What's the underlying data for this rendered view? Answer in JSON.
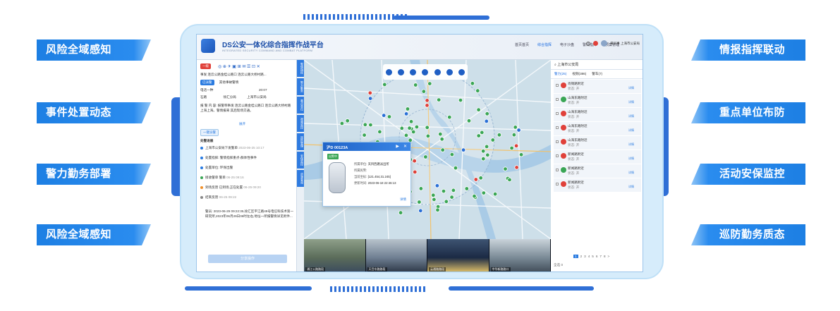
{
  "left_features": [
    "风险全域感知",
    "事件处置动态",
    "警力勤务部署",
    "风险全域感知"
  ],
  "right_features": [
    "情报指挥联动",
    "重点单位布防",
    "活动安保监控",
    "巡防勤务质态"
  ],
  "app": {
    "title": "DS公安一体化综合指挥作战平台",
    "subtitle": "INTEGRATED SECURITY COMMAND AND COMBAT PLATFORM",
    "nav": [
      "首页首页",
      "综合指挥",
      "电子沙盘",
      "警情指挥",
      "预案管理"
    ],
    "nav_active": 1,
    "user_label": "黄同事 上海市公安局"
  },
  "left_panel": {
    "tag": "一级",
    "event_title": "事发 连云公路金桂公路口 连云公路大桥村路...",
    "tags": [
      "已派警",
      "其他事故警情"
    ],
    "phone_label": "电话一种",
    "time_label": "20:07",
    "row3_a": "石路",
    "row3_b": "徐汇分局",
    "row3_c": "上海市公安局",
    "report_text": "报 警 内 容: 报警称事发 连云公路金桂公路口 连云公路大桥村路 上海上海。警情报来 其后现场交通。",
    "expand_label": "展开",
    "section_btn": "一键派警",
    "section_title": "处警进展",
    "timeline": [
      {
        "time": "2023-06-25 10:17",
        "text": "上海市公安局下发警单",
        "color": "#2a7be0"
      },
      {
        "time": "",
        "text": "处置指挥: 警情指挥重点-群体性事件",
        "color": "#2a7be0"
      },
      {
        "time": "",
        "text": "处置单位: 环保出警",
        "color": "#2a7be0"
      },
      {
        "time": "06-25 09:16",
        "text": "接收警单 警单",
        "color": "#3aa655"
      },
      {
        "time": "06-25 09:20",
        "text": "到场反馈 已到场,正在处置",
        "color": "#f0902a"
      },
      {
        "time": "06-25 09:22",
        "text": "结束反馈",
        "color": "#888888"
      }
    ],
    "feedback_text": "警员: 2023-06-29 09:22:35,徐汇区平江路49号电信科技术第一研究所,2023年06月29日08时左右,地址一所报警情详见附件...",
    "submit_label": "分享操作"
  },
  "vertical_tabs": [
    "警情指挥",
    "警力勤务",
    "重点单位",
    "视频监控",
    "巡防管理",
    "安保监控",
    "资源查询"
  ],
  "map_search": {
    "placeholder": "上海市公安局"
  },
  "popup": {
    "title": "沪D 00123A",
    "badge": "出警中",
    "fields": [
      {
        "k": "所属单位",
        "v": "天目西路派出所"
      },
      {
        "k": "所属民警",
        "v": ""
      },
      {
        "k": "当前坐标",
        "v": "[121.454,31.245]"
      },
      {
        "k": "更新时间",
        "v": "2023-06-18 22:46:13"
      }
    ],
    "link": "详情"
  },
  "videos": [
    {
      "label": "浦江公路路段"
    },
    {
      "label": "天目东路路段"
    },
    {
      "label": "云通路路段"
    },
    {
      "label": "中华新路路口"
    }
  ],
  "right_panel": {
    "tabs": [
      "警力(25)",
      "视频(386)",
      "警车(7)"
    ],
    "items": [
      {
        "name": "肖锡路附近",
        "status": "状态: 开",
        "icon_color": "#e0413a"
      },
      {
        "name": "山海东路附近",
        "status": "状态: 开",
        "icon_color": "#3aa655"
      },
      {
        "name": "山海东路附近",
        "status": "状态: 开",
        "icon_color": "#e0413a"
      },
      {
        "name": "山海东路附近",
        "status": "状态: 开",
        "icon_color": "#e0413a"
      },
      {
        "name": "山海东路附近",
        "status": "状态: 开",
        "icon_color": "#e0413a"
      },
      {
        "name": "新闻路附近",
        "status": "状态: 开",
        "icon_color": "#e0413a"
      },
      {
        "name": "新闻路附近",
        "status": "状态: 开",
        "icon_color": "#3aa655"
      },
      {
        "name": "新闻路附近",
        "status": "状态: 开",
        "icon_color": "#e0413a"
      }
    ],
    "status_link": "详情",
    "pages": [
      "1",
      "2",
      "3",
      "4",
      "5",
      "6",
      "7",
      "8",
      ">"
    ],
    "active_page": 0,
    "footer": "全选 0"
  },
  "colors": {
    "brand": "#1d7fe3",
    "frame": "#2f6fd6",
    "map": "#c6dae9"
  }
}
